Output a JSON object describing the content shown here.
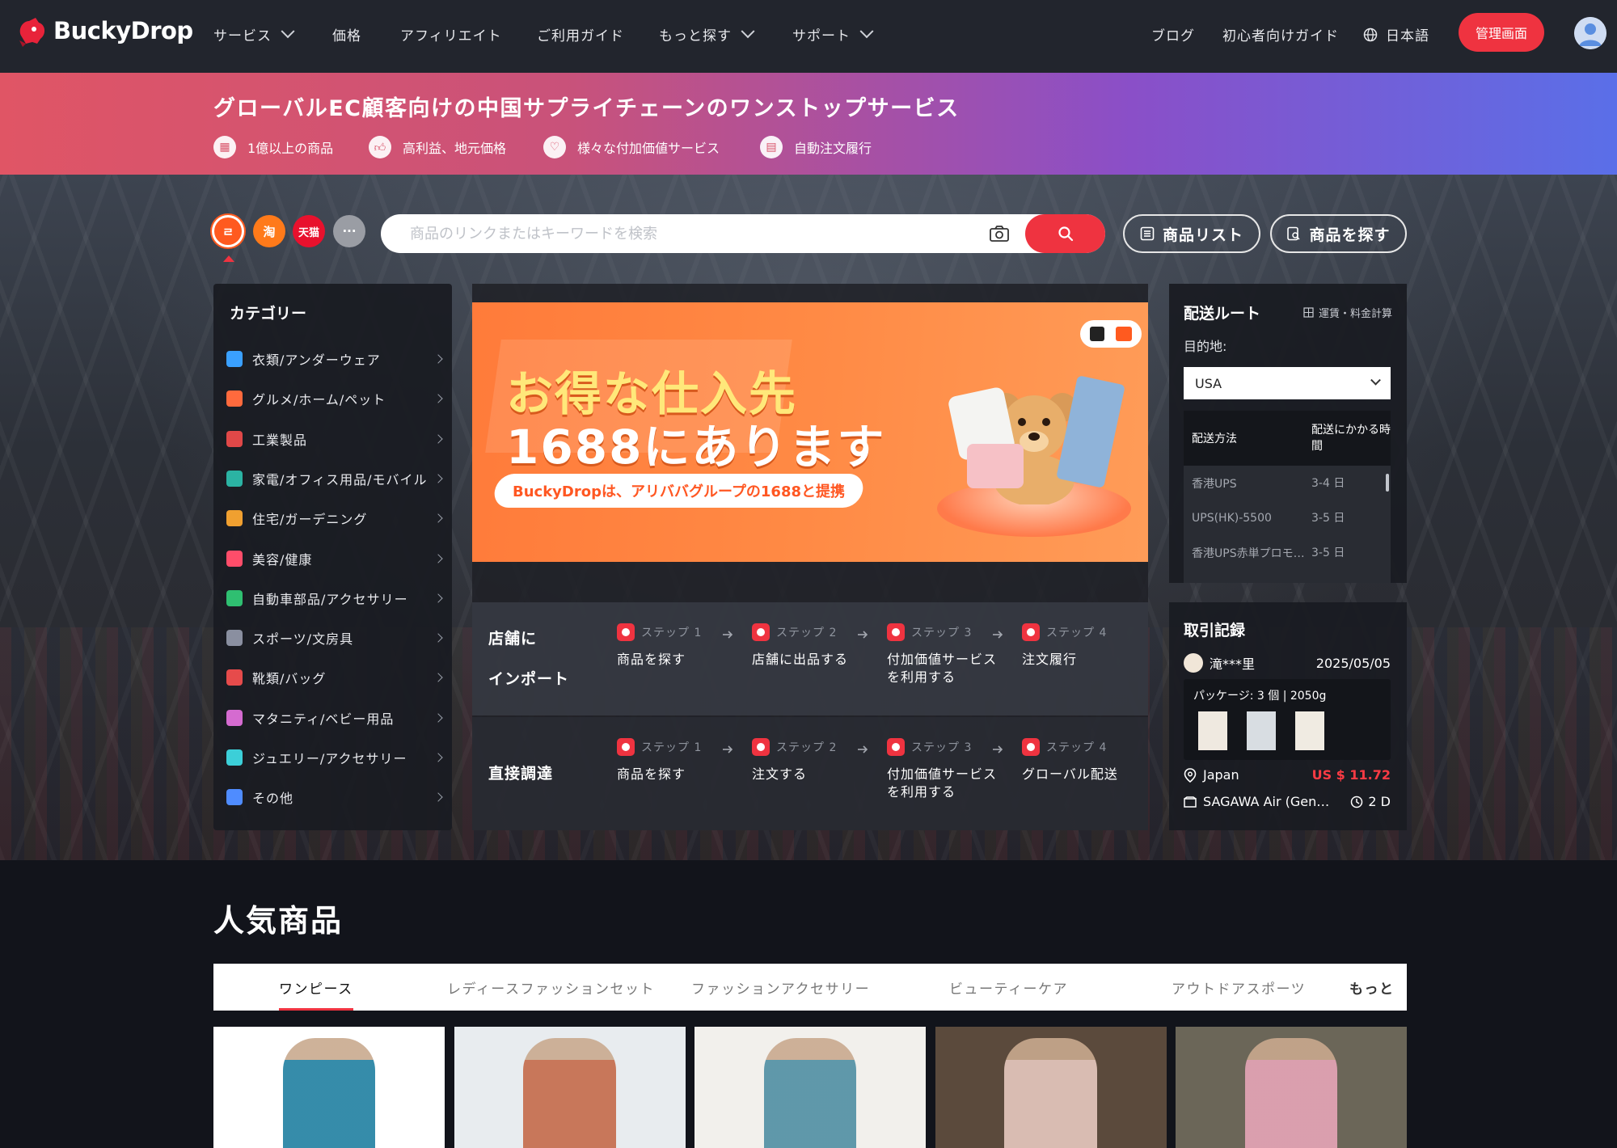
{
  "brand": {
    "name": "BuckyDrop"
  },
  "nav": {
    "items": [
      {
        "label": "サービス",
        "dropdown": true
      },
      {
        "label": "価格",
        "dropdown": false
      },
      {
        "label": "アフィリエイト",
        "dropdown": false
      },
      {
        "label": "ご利用ガイド",
        "dropdown": false
      },
      {
        "label": "もっと探す",
        "dropdown": true
      },
      {
        "label": "サポート",
        "dropdown": true
      }
    ],
    "blog": "ブログ",
    "beginner_guide": "初心者向けガイド",
    "language": "日本語",
    "admin_button": "管理画面"
  },
  "strip": {
    "title": "グローバルEC顧客向けの中国サプライチェーンのワンストップサービス",
    "features": [
      {
        "icon": "grid-icon",
        "label": "1億以上の商品"
      },
      {
        "icon": "thumbs-up-icon",
        "label": "高利益、地元価格"
      },
      {
        "icon": "heart-icon",
        "label": "様々な付加価値サービス"
      },
      {
        "icon": "order-icon",
        "label": "自動注文履行"
      }
    ]
  },
  "platforms": [
    {
      "name": "1688",
      "glyph": "ㄹ",
      "color": "#ff5a1f",
      "selected": true
    },
    {
      "name": "taobao",
      "glyph": "淘",
      "color": "#ff7a1a",
      "selected": false
    },
    {
      "name": "tmall",
      "glyph": "天猫",
      "color": "#e8112d",
      "selected": false
    },
    {
      "name": "more",
      "glyph": "···",
      "color": "#9a9da4",
      "selected": false
    }
  ],
  "search": {
    "placeholder": "商品のリンクまたはキーワードを検索",
    "value": ""
  },
  "actions": {
    "product_list": "商品リスト",
    "find_products": "商品を探す"
  },
  "categories": {
    "title": "カテゴリー",
    "items": [
      {
        "label": "衣類/アンダーウェア",
        "color": "#3aa0ff"
      },
      {
        "label": "グルメ/ホーム/ペット",
        "color": "#ff6a3d"
      },
      {
        "label": "工業製品",
        "color": "#e04848"
      },
      {
        "label": "家電/オフィス用品/モバイル",
        "color": "#2bb3a3"
      },
      {
        "label": "住宅/ガーデニング",
        "color": "#f0a030"
      },
      {
        "label": "美容/健康",
        "color": "#ff4d6a"
      },
      {
        "label": "自動車部品/アクセサリー",
        "color": "#2fbf71"
      },
      {
        "label": "スポーツ/文房具",
        "color": "#8a8fa0"
      },
      {
        "label": "靴類/バッグ",
        "color": "#e64b4b"
      },
      {
        "label": "マタニティ/ベビー用品",
        "color": "#d56bd0"
      },
      {
        "label": "ジュエリー/アクセサリー",
        "color": "#3ccfd8"
      },
      {
        "label": "その他",
        "color": "#4f8cff"
      }
    ]
  },
  "promo": {
    "headline1": "お得な仕入先",
    "headline2": "1688にあります",
    "tagline": "BuckyDropは、アリババグループの1688と提携"
  },
  "steps": {
    "rows": [
      {
        "title_line1": "店舗に",
        "title_line2": "インポート",
        "steps": [
          {
            "step": "ステップ 1",
            "label": "商品を探す",
            "icon": "search-icon"
          },
          {
            "step": "ステップ 2",
            "label": "店舗に出品する",
            "icon": "upload-icon"
          },
          {
            "step": "ステップ 3",
            "label": "付加価値サービスを利用する",
            "icon": "heart-icon"
          },
          {
            "step": "ステップ 4",
            "label": "注文履行",
            "icon": "order-icon"
          }
        ]
      },
      {
        "title_line1": "直接調達",
        "title_line2": "",
        "steps": [
          {
            "step": "ステップ 1",
            "label": "商品を探す",
            "icon": "search-icon"
          },
          {
            "step": "ステップ 2",
            "label": "注文する",
            "icon": "bag-icon"
          },
          {
            "step": "ステップ 3",
            "label": "付加価値サービスを利用する",
            "icon": "heart-icon"
          },
          {
            "step": "ステップ 4",
            "label": "グローバル配送",
            "icon": "truck-icon"
          }
        ]
      }
    ]
  },
  "shipping": {
    "title": "配送ルート",
    "calc_link": "運賃・料金計算",
    "destination_label": "目的地:",
    "destination_value": "USA",
    "col_method": "配送方法",
    "col_time": "配送にかかる時間",
    "rows": [
      {
        "method": "香港UPS",
        "time": "3-4 日"
      },
      {
        "method": "UPS(HK)-5500",
        "time": "3-5 日"
      },
      {
        "method": "香港UPS赤単プロモーション",
        "time": "3-5 日"
      }
    ]
  },
  "trade": {
    "title": "取引記録",
    "user": "滝***里",
    "date": "2025/05/05",
    "package": "パッケージ: 3 個 | 2050g",
    "country": "Japan",
    "price": "US $ 11.72",
    "route": "SAGAWA Air (General)",
    "days": "2 D"
  },
  "popular": {
    "title": "人気商品",
    "tabs": [
      {
        "label": "ワンピース",
        "active": true
      },
      {
        "label": "レディースファッションセット",
        "active": false
      },
      {
        "label": "ファッションアクセサリー",
        "active": false
      },
      {
        "label": "ビューティーケア",
        "active": false
      },
      {
        "label": "アウトドアスポーツ",
        "active": false
      }
    ],
    "more": "もっと",
    "products": [
      {
        "image": "dress-teal-skirt",
        "bg": "#ffffff"
      },
      {
        "image": "dress-floral",
        "bg": "#e8ecef"
      },
      {
        "image": "dress-blue-tshirt",
        "bg": "#f2f0ec"
      },
      {
        "image": "dress-pink-slip",
        "bg": "#5b4a3c"
      },
      {
        "image": "dress-sequin-pink",
        "bg": "#6b6658"
      }
    ]
  },
  "colors": {
    "accent": "#ef3340",
    "nav_bg": "#22252d",
    "panel_bg": "#1a1c22"
  }
}
